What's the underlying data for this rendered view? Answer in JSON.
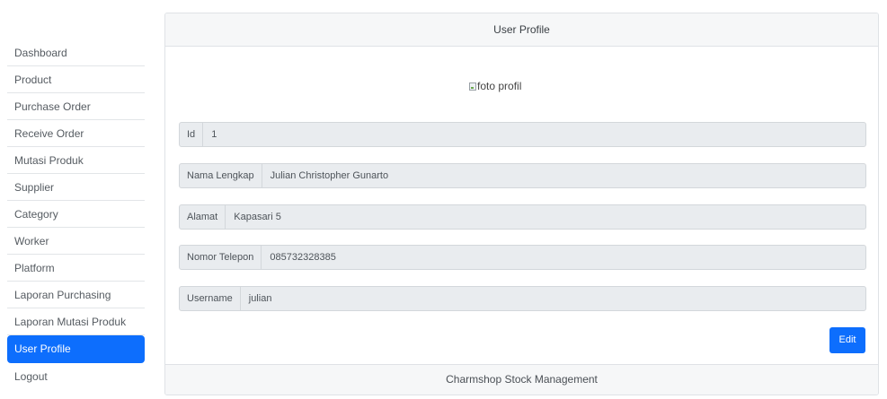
{
  "sidebar": {
    "items": [
      {
        "label": "Dashboard"
      },
      {
        "label": "Product"
      },
      {
        "label": "Purchase Order"
      },
      {
        "label": "Receive Order"
      },
      {
        "label": "Mutasi Produk"
      },
      {
        "label": "Supplier"
      },
      {
        "label": "Category"
      },
      {
        "label": "Worker"
      },
      {
        "label": "Platform"
      },
      {
        "label": "Laporan Purchasing"
      },
      {
        "label": "Laporan Mutasi Produk"
      },
      {
        "label": "User Profile",
        "active": true
      },
      {
        "label": "Logout"
      }
    ],
    "active_color": "#0d6efd"
  },
  "card": {
    "header": "User Profile",
    "photo_alt": "foto profil",
    "fields": [
      {
        "label": "Id",
        "value": "1"
      },
      {
        "label": "Nama Lengkap",
        "value": "Julian Christopher Gunarto"
      },
      {
        "label": "Alamat",
        "value": "Kapasari 5"
      },
      {
        "label": "Nomor Telepon",
        "value": "085732328385"
      },
      {
        "label": "Username",
        "value": "julian"
      }
    ],
    "edit_label": "Edit",
    "footer": "Charmshop Stock Management"
  }
}
